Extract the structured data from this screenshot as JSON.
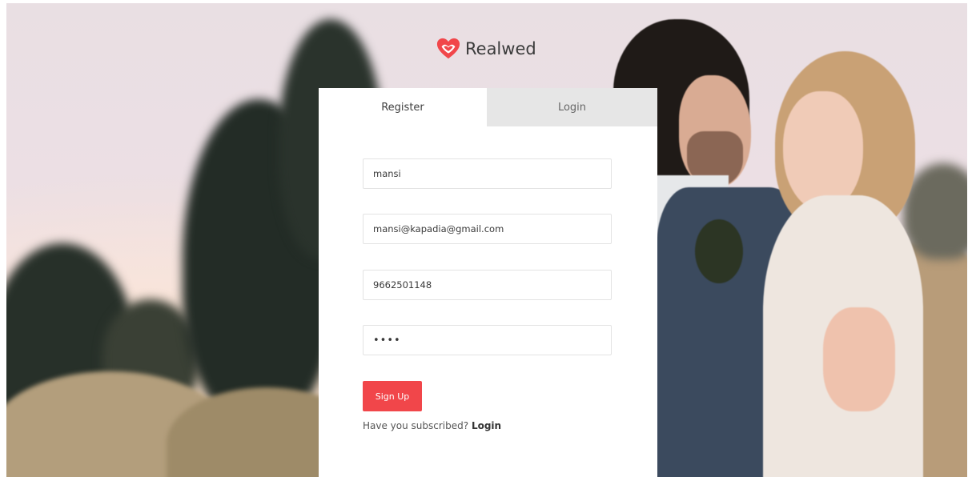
{
  "brand": {
    "name": "Realwed",
    "color": "#f1464a"
  },
  "tabs": {
    "register": "Register",
    "login": "Login"
  },
  "form": {
    "name_value": "mansi",
    "email_value": "mansi@kapadia@gmail.com",
    "phone_value": "9662501148",
    "password_value": "••••",
    "submit_label": "Sign Up",
    "prompt_text": "Have you subscribed?",
    "prompt_link": "Login"
  },
  "icons": {
    "logo": "heart-icon"
  },
  "colors": {
    "accent": "#f1464a",
    "inactive_tab": "#e6e6e6"
  }
}
